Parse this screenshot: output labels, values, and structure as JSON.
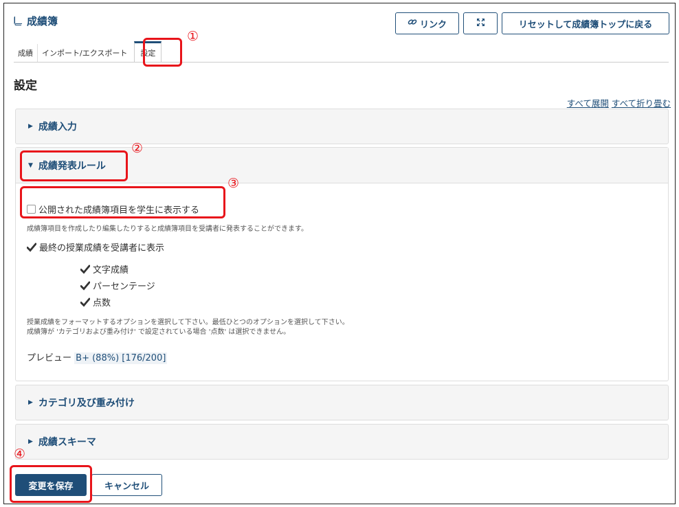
{
  "header": {
    "title": "成績簿",
    "link_button": "リンク",
    "reset_button": "リセットして成績簿トップに戻る"
  },
  "tabs": [
    {
      "label": "成績"
    },
    {
      "label": "インポート/エクスポート"
    },
    {
      "label": "設定"
    }
  ],
  "page_title": "設定",
  "expand_links": {
    "expand_all": "すべて展開",
    "collapse_all": "すべて折り畳む"
  },
  "panels": {
    "grade_entry": "成績入力",
    "release_rules": "成績発表ルール",
    "categories": "カテゴリ及び重み付け",
    "grading_schema": "成績スキーマ"
  },
  "release": {
    "show_items_label": "公開された成績簿項目を学生に表示する",
    "show_items_checked": false,
    "show_items_help": "成績簿項目を作成したり編集したりすると成績簿項目を受講者に発表することができます。",
    "final_grade_label": "最終の授業成績を受講者に表示",
    "final_grade_checked": true,
    "options": [
      {
        "label": "文字成績",
        "checked": true
      },
      {
        "label": "パーセンテージ",
        "checked": true
      },
      {
        "label": "点数",
        "checked": true
      }
    ],
    "format_help_1": "授業成績をフォーマットするオプションを選択して下さい。最低ひとつのオプションを選択して下さい。",
    "format_help_2": "成績簿が 'カテゴリおよび重み付け' で設定されている場合 '点数' は選択できません。",
    "preview_label": "プレビュー",
    "preview_value": "B+ (88%) [176/200]"
  },
  "actions": {
    "save": "変更を保存",
    "cancel": "キャンセル"
  },
  "annotations": [
    "①",
    "②",
    "③",
    "④"
  ],
  "colors": {
    "brand": "#1f4e78",
    "annotation": "#e8141a"
  }
}
